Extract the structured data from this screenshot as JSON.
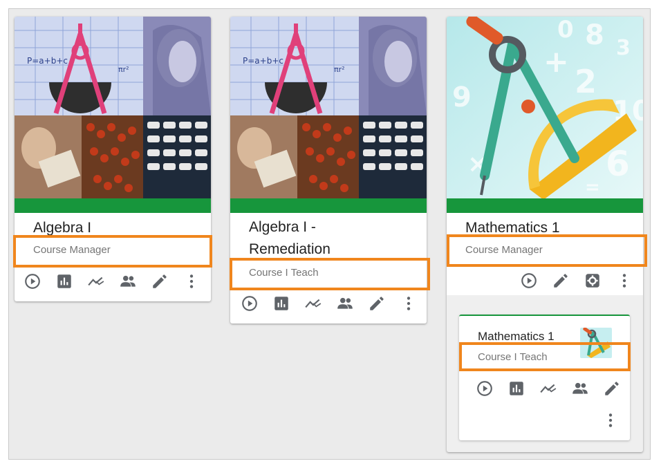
{
  "cards": [
    {
      "title": "Algebra I",
      "role": "Course Manager"
    },
    {
      "title_line1": "Algebra I -",
      "title_line2": "Remediation",
      "role": "Course I Teach"
    },
    {
      "title": "Mathematics 1",
      "role": "Course Manager"
    }
  ],
  "subcard": {
    "title": "Mathematics 1",
    "role": "Course I Teach"
  },
  "icons": {
    "play": "play-circle-icon",
    "report": "bar-chart-icon",
    "trend": "trending-icon",
    "people": "people-icon",
    "edit": "pencil-icon",
    "more": "more-vert-icon",
    "settings": "gear-icon"
  },
  "colors": {
    "highlight": "#f0861d",
    "green_bar": "#17963c",
    "icon": "#5f6368"
  }
}
